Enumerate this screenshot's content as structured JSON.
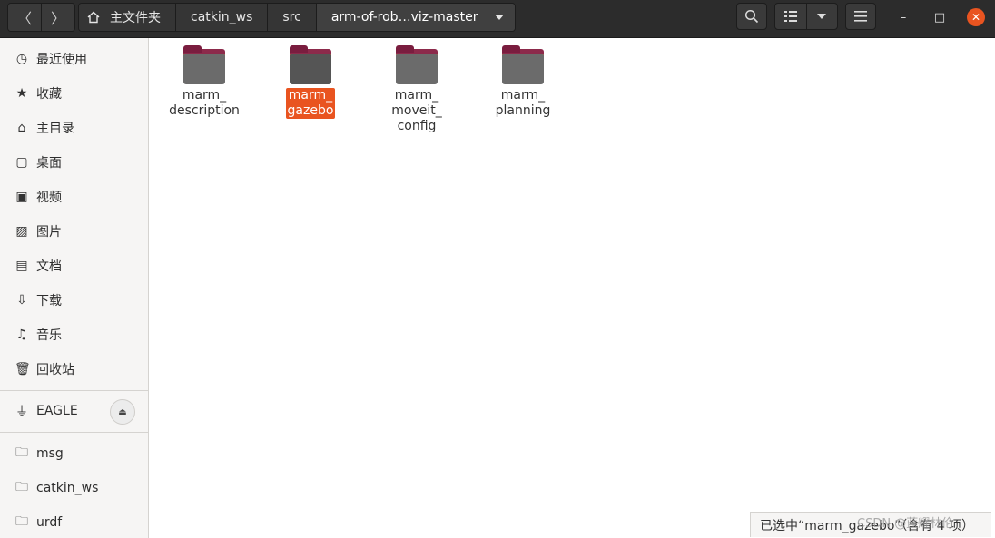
{
  "header": {
    "back_icon": "chevron-left-icon",
    "forward_icon": "chevron-right-icon",
    "breadcrumbs": [
      "主文件夹",
      "catkin_ws",
      "src",
      "arm-of-rob…viz-master"
    ],
    "search_icon": "search-icon",
    "view_icon": "list-view-icon",
    "menu_icon": "hamburger-menu-icon",
    "window_controls": {
      "minimize": "–",
      "maximize": "□",
      "close": "✕"
    },
    "accent": "#e95420"
  },
  "sidebar": {
    "places": [
      {
        "label": "最近使用",
        "icon": "clock-icon"
      },
      {
        "label": "收藏",
        "icon": "star-icon"
      },
      {
        "label": "主目录",
        "icon": "home-icon"
      },
      {
        "label": "桌面",
        "icon": "desktop-icon"
      },
      {
        "label": "视频",
        "icon": "video-icon"
      },
      {
        "label": "图片",
        "icon": "picture-icon"
      },
      {
        "label": "文档",
        "icon": "document-icon"
      },
      {
        "label": "下载",
        "icon": "download-icon"
      },
      {
        "label": "音乐",
        "icon": "music-icon"
      },
      {
        "label": "回收站",
        "icon": "trash-icon"
      }
    ],
    "devices": [
      {
        "label": "EAGLE",
        "icon": "usb-drive-icon"
      }
    ],
    "bookmarks": [
      {
        "label": "msg",
        "icon": "folder-icon"
      },
      {
        "label": "catkin_ws",
        "icon": "folder-icon"
      },
      {
        "label": "urdf",
        "icon": "folder-icon"
      }
    ]
  },
  "files": [
    {
      "name_lines": [
        "marm_",
        "description"
      ],
      "selected": false
    },
    {
      "name_lines": [
        "marm_",
        "gazebo"
      ],
      "selected": true
    },
    {
      "name_lines": [
        "marm_",
        "moveit_",
        "config"
      ],
      "selected": false
    },
    {
      "name_lines": [
        "marm_",
        "planning"
      ],
      "selected": false
    }
  ],
  "status": {
    "text": "已选中“marm_gazebo”（含有 4 项）"
  },
  "watermark": "CSDN @蓝耀林伦"
}
